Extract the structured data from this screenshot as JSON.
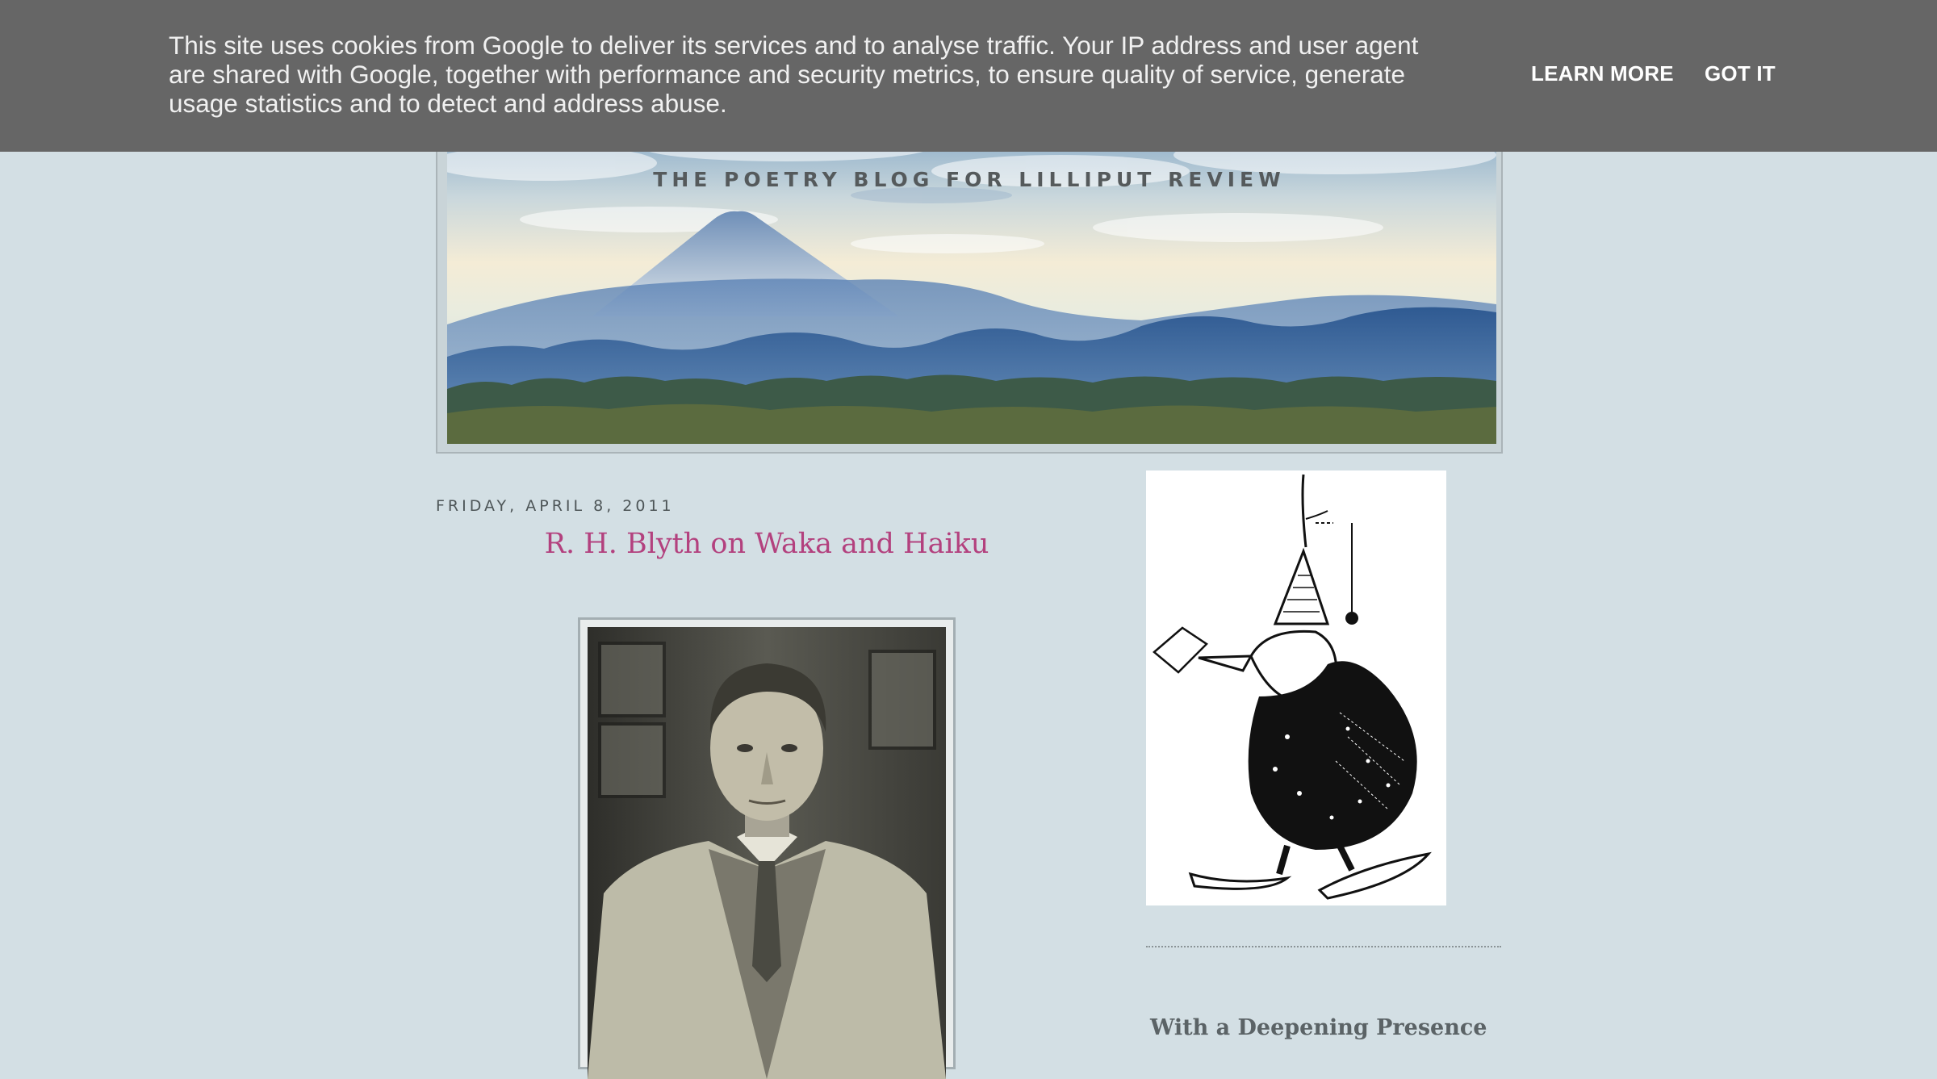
{
  "cookie_bar": {
    "text": "This site uses cookies from Google to deliver its services and to analyse traffic. Your IP address and user agent are shared with Google, together with performance and security metrics, to ensure quality of service, generate usage statistics and to detect and address abuse.",
    "learn_more": "LEARN MORE",
    "got_it": "GOT IT"
  },
  "header": {
    "description": "THE POETRY BLOG FOR LILLIPUT REVIEW"
  },
  "post": {
    "date": "FRIDAY, APRIL 8, 2011",
    "title": "R. H. Blyth on Waka and Haiku"
  },
  "sidebar": {
    "heading": "With a Deepening Presence"
  },
  "colors": {
    "background": "#d3dfe4",
    "cookie_bar": "#666666",
    "post_title": "#b3417e"
  }
}
